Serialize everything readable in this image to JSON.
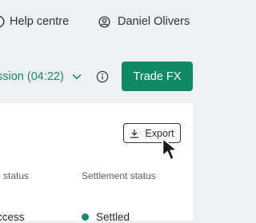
{
  "header": {
    "help_label": "Help centre",
    "help_icon": "question-circle-icon",
    "user_name": "Daniel Olivers",
    "user_icon": "user-circle-icon"
  },
  "toolbar": {
    "session_label": "ssion (04:22)",
    "session_icon": "chevron-down-icon",
    "info_icon": "info-circle-icon",
    "trade_label": "Trade FX"
  },
  "table": {
    "export_label": "Export",
    "export_icon": "download-icon",
    "columns": [
      "g status",
      "Settlement status"
    ],
    "rows": [
      {
        "trading": "ccess",
        "settlement": "Settled"
      }
    ]
  },
  "colors": {
    "accent": "#0f8a66",
    "accent_text": "#158a6c",
    "page_bg": "#eef1f4",
    "card_bg": "#ffffff"
  }
}
